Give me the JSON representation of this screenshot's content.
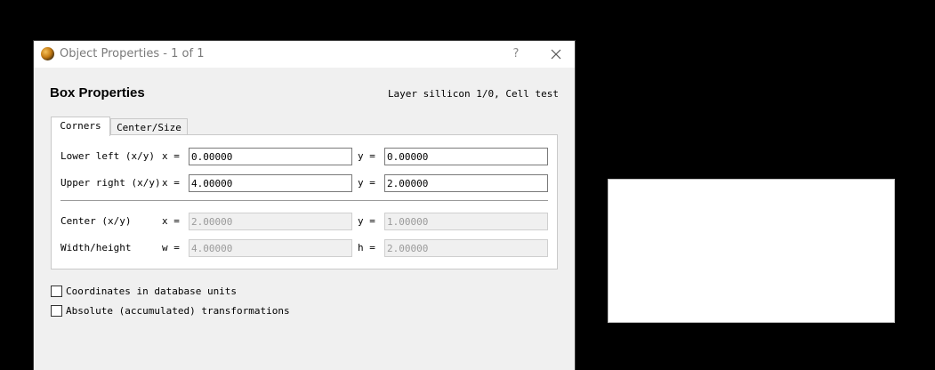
{
  "window": {
    "title": "Object Properties - 1 of 1",
    "help_label": "?",
    "icon": "klayout-app-icon"
  },
  "header": {
    "heading": "Box Properties",
    "layer_info": "Layer sillicon 1/0, Cell test"
  },
  "tabs": [
    {
      "label": "Corners",
      "selected": true
    },
    {
      "label": "Center/Size",
      "selected": false
    }
  ],
  "corners": {
    "lower_left": {
      "label": "Lower left (x/y)",
      "x_label": "x =",
      "x_value": "0.00000",
      "y_label": "y =",
      "y_value": "0.00000"
    },
    "upper_right": {
      "label": "Upper right (x/y)",
      "x_label": "x =",
      "x_value": "4.00000",
      "y_label": "y =",
      "y_value": "2.00000"
    },
    "center": {
      "label": "Center (x/y)",
      "x_label": "x =",
      "x_value": "2.00000",
      "y_label": "y =",
      "y_value": "1.00000"
    },
    "size": {
      "label": "Width/height",
      "w_label": "w =",
      "w_value": "4.00000",
      "h_label": "h =",
      "h_value": "2.00000"
    }
  },
  "options": {
    "dbu": {
      "label": "Coordinates in database units",
      "checked": false
    },
    "absolute": {
      "label": "Absolute (accumulated) transformations",
      "checked": false
    }
  },
  "colors": {
    "background": "#000000",
    "dialog_bg": "#f0f0f0",
    "panel_bg": "#ffffff",
    "canvas_shape": "#ffffff"
  }
}
